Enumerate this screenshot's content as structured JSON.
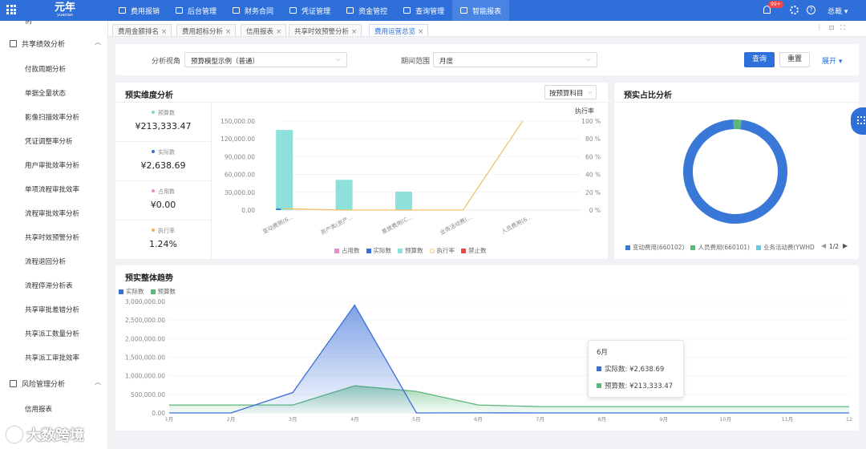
{
  "app": {
    "logo": "元年",
    "logo_sub": "yuanian"
  },
  "nav": [
    {
      "label": "费用报销",
      "active": false
    },
    {
      "label": "后台管理",
      "active": false
    },
    {
      "label": "财务合同",
      "active": false
    },
    {
      "label": "凭证管理",
      "active": false
    },
    {
      "label": "资金管控",
      "active": false
    },
    {
      "label": "查询管理",
      "active": false
    },
    {
      "label": "智能报表",
      "active": true
    }
  ],
  "topbar": {
    "notification_count": "99+",
    "help": "?",
    "user": "总裁 ▾"
  },
  "sidebar": {
    "groups": [
      {
        "label": "共享绩效分析",
        "items": [
          "付款周期分析",
          "单据全量状态",
          "影像扫描效率分析",
          "凭证调整率分析",
          "用户审批效率分析",
          "单项流程审批效率",
          "流程审批效率分析",
          "共享时效预警分析",
          "流程退回分析",
          "流程停滞分析表",
          "共享审批差错分析",
          "共享派工数量分析",
          "共享派工审批效率"
        ]
      },
      {
        "label": "风险管理分析",
        "items": [
          "信用报表"
        ]
      }
    ]
  },
  "tabs": [
    {
      "label": "费用金额排名",
      "active": false
    },
    {
      "label": "费用超标分析",
      "active": false
    },
    {
      "label": "信用报表",
      "active": false
    },
    {
      "label": "共享时效预警分析",
      "active": false
    },
    {
      "label": "费用运营总览",
      "active": true
    }
  ],
  "filters": {
    "view_label": "分析视角",
    "view_value": "预算模型示例（普通）",
    "period_label": "期间范围",
    "period_value": "月度",
    "query_btn": "查询",
    "reset_btn": "重置",
    "expand_link": "展开 ▾"
  },
  "dimension_panel": {
    "title": "预实维度分析",
    "selector": "按预算科目",
    "kpis": [
      {
        "label": "预算数",
        "value": "¥213,333.47",
        "color": "#7fd6cf"
      },
      {
        "label": "实际数",
        "value": "¥2,638.69",
        "color": "#3a6fd8"
      },
      {
        "label": "占用数",
        "value": "¥0.00",
        "color": "#e48fd0"
      },
      {
        "label": "执行率",
        "value": "1.24%",
        "color": "#f2b24a"
      }
    ]
  },
  "ratio_panel": {
    "title": "预实占比分析",
    "legend": [
      "变动费用(660102)",
      "人员费用(660101)",
      "业务活动费(YWHD"
    ],
    "pager": "1/2"
  },
  "trend_panel": {
    "title": "预实整体趋势"
  },
  "tooltip": {
    "title": "6月",
    "rows": [
      {
        "label": "实际数: ¥2,638.69",
        "color": "#3a6fd8"
      },
      {
        "label": "预算数: ¥213,333.47",
        "color": "#5bb77a"
      }
    ]
  },
  "watermark": "大数跨境",
  "chart_data": [
    {
      "type": "bar",
      "categories": [
        "变动费用(6...",
        "资产类(资产...",
        "差旅费用(C...",
        "业务活动费(...",
        "人员费用(6..."
      ],
      "series": [
        {
          "name": "占用数",
          "values": [
            0,
            0,
            0,
            0,
            0
          ],
          "color": "#e48fd0"
        },
        {
          "name": "实际数",
          "values": [
            2500,
            0,
            0,
            0,
            0
          ],
          "color": "#3a6fd8"
        },
        {
          "name": "预算数",
          "values": [
            135000,
            51000,
            31000,
            0,
            0
          ],
          "color": "#8ee0da"
        },
        {
          "name": "执行率",
          "type": "line",
          "axis": "right",
          "values": [
            1.5,
            0,
            0,
            0,
            100
          ],
          "color": "#f2c26a"
        },
        {
          "name": "禁止数",
          "values": [
            0,
            0,
            0,
            0,
            0
          ],
          "color": "#e84a4a"
        }
      ],
      "y_ticks": [
        "150,000.00",
        "120,000.00",
        "90,000.00",
        "60,000.00",
        "30,000.00",
        "0.00"
      ],
      "ylim": [
        0,
        150000
      ],
      "y2label": "执行率",
      "y2_ticks": [
        "100 %",
        "80 %",
        "60 %",
        "40 %",
        "20 %",
        "0 %"
      ],
      "y2lim": [
        0,
        100
      ]
    },
    {
      "type": "pie",
      "donut": true,
      "labels": [
        "变动费用(660102)",
        "人员费用(660101)",
        "业务活动费(YWHD"
      ],
      "values": [
        97.5,
        2.5,
        0
      ],
      "colors": [
        "#3a78d8",
        "#5bb77a",
        "#6cc6e0"
      ]
    },
    {
      "type": "area",
      "categories": [
        "1月",
        "2月",
        "3月",
        "4月",
        "5月",
        "6月",
        "7月",
        "8月",
        "9月",
        "10月",
        "11月",
        "12"
      ],
      "series": [
        {
          "name": "实际数",
          "values": [
            0,
            0,
            550000,
            2900000,
            0,
            2638.69,
            0,
            0,
            0,
            0,
            0,
            0
          ],
          "color": "#3a6fd8"
        },
        {
          "name": "预算数",
          "values": [
            213333,
            213333,
            213333,
            730000,
            580000,
            213333.47,
            170000,
            170000,
            170000,
            170000,
            170000,
            170000
          ],
          "color": "#5bb77a"
        }
      ],
      "y_ticks": [
        "3,000,000.00",
        "2,500,000.00",
        "2,000,000.00",
        "1,500,000.00",
        "1,000,000.00",
        "500,000.00",
        "0.00"
      ],
      "ylim": [
        0,
        3000000
      ]
    }
  ]
}
